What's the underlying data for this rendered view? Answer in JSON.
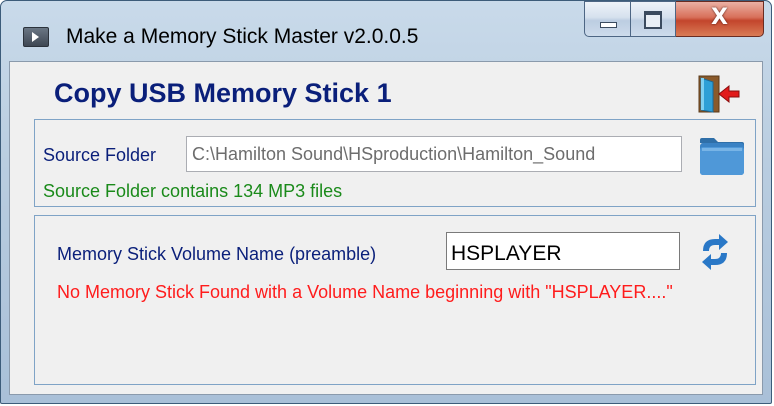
{
  "window": {
    "title": "Make a Memory Stick Master v2.0.0.5",
    "caption_close_glyph": "X"
  },
  "main": {
    "heading": "Copy USB Memory Stick 1"
  },
  "source": {
    "label": "Source Folder",
    "path": "C:\\Hamilton Sound\\HSproduction\\Hamilton_Sound",
    "status": "Source Folder contains 134 MP3 files"
  },
  "stick": {
    "label": "Memory Stick Volume Name (preamble)",
    "volume_name": "HSPLAYER",
    "error": "No Memory Stick Found with a Volume Name beginning with \"HSPLAYER....\""
  },
  "icons": {
    "app": "app-icon",
    "exit": "exit-door-icon",
    "folder": "folder-icon",
    "refresh": "refresh-icon"
  },
  "colors": {
    "heading": "#0a1f7a",
    "status_ok": "#1a8a1a",
    "status_error": "#ff1c1c",
    "close_button": "#c3452c"
  }
}
